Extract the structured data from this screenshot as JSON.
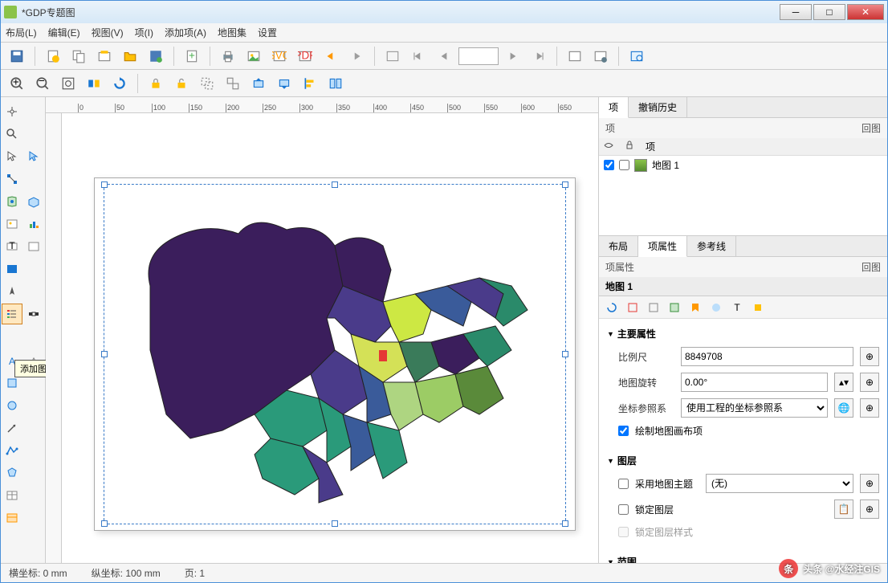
{
  "title": "*GDP专题图",
  "menu": [
    "布局(L)",
    "编辑(E)",
    "视图(V)",
    "项(I)",
    "添加项(A)",
    "地图集",
    "设置"
  ],
  "tooltip": "添加图例",
  "right": {
    "tabs": [
      "项",
      "撤销历史"
    ],
    "sub": "项",
    "subright": "回图",
    "layer_cols": [
      "",
      "",
      "项"
    ],
    "layer_name": "地图 1",
    "prop_tabs": [
      "布局",
      "项属性",
      "参考线"
    ],
    "prop_tabs_active": 1,
    "prop_sub": "项属性",
    "prop_subright": "回图",
    "prop_header": "地图 1",
    "sec_main": "主要属性",
    "scale_label": "比例尺",
    "scale_value": "8849708",
    "rot_label": "地图旋转",
    "rot_value": "0.00°",
    "crs_label": "坐标参照系",
    "crs_value": "使用工程的坐标参照系",
    "draw_check": "绘制地图画布项",
    "sec_layers": "图层",
    "theme_check": "采用地图主题",
    "theme_value": "(无)",
    "lock_check": "锁定图层",
    "lockstyle_check": "锁定图层样式",
    "sec_extent": "范围"
  },
  "status": {
    "left": "横坐标: 0 mm",
    "mid": "纵坐标: 100 mm",
    "page": "页: 1"
  },
  "watermark": "头条 @水经注GIS",
  "ruler_ticks": [
    0,
    50,
    100,
    150,
    200,
    250,
    300,
    350,
    400,
    450,
    500,
    550,
    600,
    650
  ]
}
